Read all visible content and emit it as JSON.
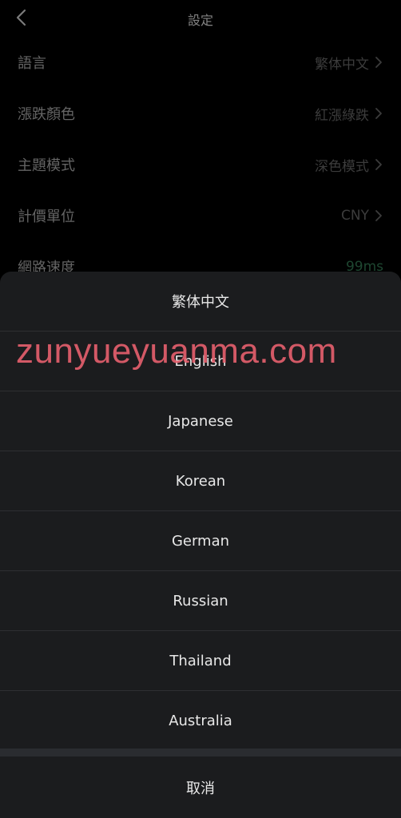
{
  "header": {
    "title": "設定",
    "back_icon": "chevron-left-icon"
  },
  "settings": {
    "items": [
      {
        "label": "語言",
        "value": "繁体中文",
        "has_chevron": true
      },
      {
        "label": "漲跌顏色",
        "value": "紅漲綠跌",
        "has_chevron": true
      },
      {
        "label": "主題模式",
        "value": "深色模式",
        "has_chevron": true
      },
      {
        "label": "計價單位",
        "value": "CNY",
        "has_chevron": true
      },
      {
        "label": "網路速度",
        "value": "99ms",
        "has_chevron": false
      }
    ]
  },
  "language_sheet": {
    "options": [
      "繁体中文",
      "English",
      "Japanese",
      "Korean",
      "German",
      "Russian",
      "Thailand",
      "Australia"
    ],
    "cancel_label": "取消"
  },
  "watermark": {
    "text": "zunyueyuanma.com"
  },
  "colors": {
    "background": "#000000",
    "sheet": "#1b1c1e",
    "speed_good": "#2f6e4c",
    "watermark": "#e8606e"
  }
}
